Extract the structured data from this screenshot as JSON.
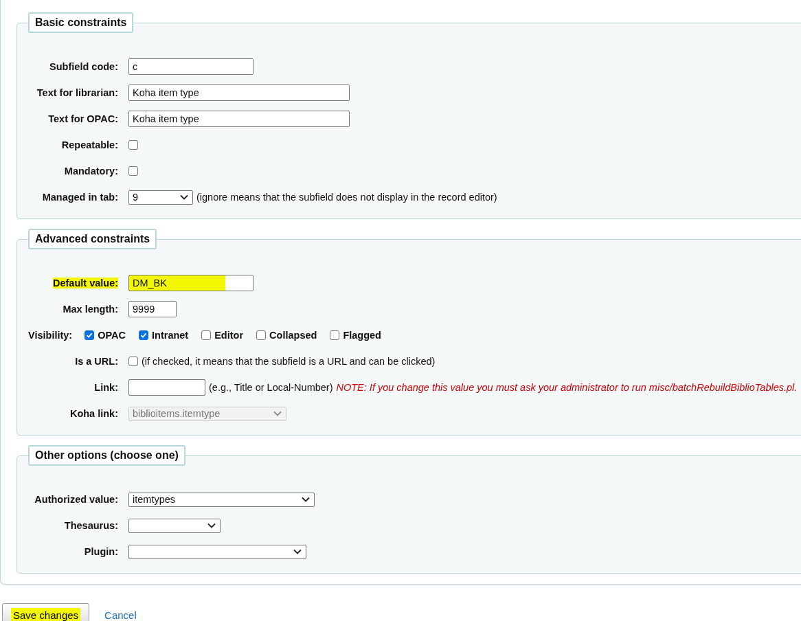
{
  "sections": [
    {
      "legend": "Basic constraints",
      "rows": [
        {
          "kind": "text",
          "label": "Subfield code:",
          "value": "c",
          "highlighted": false
        },
        {
          "kind": "text",
          "label": "Text for librarian:",
          "value": "Koha item type",
          "highlighted": false
        },
        {
          "kind": "text",
          "label": "Text for OPAC:",
          "value": "Koha item type",
          "highlighted": false
        },
        {
          "kind": "checkbox",
          "label": "Repeatable:",
          "checked": false
        },
        {
          "kind": "checkbox",
          "label": "Mandatory:",
          "checked": false
        },
        {
          "kind": "select",
          "label": "Managed in tab:",
          "value": "9",
          "disabled": false,
          "note": "(ignore means that the subfield does not display in the record editor)"
        }
      ]
    },
    {
      "legend": "Advanced constraints",
      "rows": [
        {
          "kind": "text",
          "label": "Default value:",
          "value": "DM_BK",
          "highlighted": true
        },
        {
          "kind": "text",
          "label": "Max length:",
          "value": "9999",
          "highlighted": false
        },
        {
          "kind": "checkgroup",
          "label": "Visibility:",
          "options": [
            {
              "label": "OPAC",
              "checked": true
            },
            {
              "label": "Intranet",
              "checked": true
            },
            {
              "label": "Editor",
              "checked": false
            },
            {
              "label": "Collapsed",
              "checked": false
            },
            {
              "label": "Flagged",
              "checked": false
            }
          ]
        },
        {
          "kind": "checkbox",
          "label": "Is a URL:",
          "checked": false,
          "note": "(if checked, it means that the subfield is a URL and can be clicked)"
        },
        {
          "kind": "text",
          "label": "Link:",
          "value": "",
          "highlighted": false,
          "note": "(e.g., Title or Local-Number)",
          "warning": "NOTE: If you change this value you must ask your administrator to run misc/batchRebuildBiblioTables.pl."
        },
        {
          "kind": "select",
          "label": "Koha link:",
          "value": "biblioitems.itemtype",
          "disabled": true
        }
      ]
    },
    {
      "legend": "Other options (choose one)",
      "rows": [
        {
          "kind": "select",
          "label": "Authorized value:",
          "value": "itemtypes",
          "disabled": false
        },
        {
          "kind": "select",
          "label": "Thesaurus:",
          "value": "",
          "disabled": false
        },
        {
          "kind": "select",
          "label": "Plugin:",
          "value": "",
          "disabled": false
        }
      ]
    }
  ],
  "actions": {
    "save": {
      "label": "Save changes",
      "highlighted": true
    },
    "cancel": "Cancel"
  }
}
